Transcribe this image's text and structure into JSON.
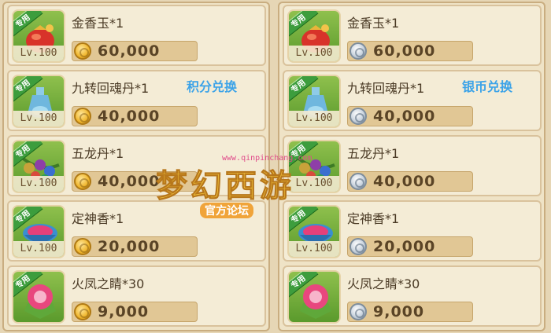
{
  "colors": {
    "badge_green": "#3d9d3d",
    "tag_blue": "#3ca3e8",
    "gold_coin": "#f0b62c",
    "silver_coin": "#c9d3de"
  },
  "left_panel": {
    "tag": "积分兑换",
    "currency_icon": "gold-coin-icon",
    "items": [
      {
        "name": "金香玉*1",
        "badge": "专用",
        "level": "Lv.100",
        "price": "60,000",
        "icon": "red-pouch-icon"
      },
      {
        "name": "九转回魂丹*1",
        "badge": "专用",
        "level": "Lv.100",
        "price": "40,000",
        "icon": "blue-vase-icon"
      },
      {
        "name": "五龙丹*1",
        "badge": "专用",
        "level": "Lv.100",
        "price": "40,000",
        "icon": "beads-branch-icon"
      },
      {
        "name": "定神香*1",
        "badge": "专用",
        "level": "Lv.100",
        "price": "20,000",
        "icon": "incense-bowl-icon"
      },
      {
        "name": "火凤之睛*30",
        "badge": "专用",
        "level": "",
        "price": "9,000",
        "icon": "pink-gem-icon"
      }
    ]
  },
  "right_panel": {
    "tag": "银币兑换",
    "currency_icon": "silver-coin-icon",
    "items": [
      {
        "name": "金香玉*1",
        "badge": "专用",
        "level": "Lv.100",
        "price": "60,000",
        "icon": "red-pouch-icon"
      },
      {
        "name": "九转回魂丹*1",
        "badge": "专用",
        "level": "Lv.100",
        "price": "40,000",
        "icon": "blue-vase-icon"
      },
      {
        "name": "五龙丹*1",
        "badge": "专用",
        "level": "Lv.100",
        "price": "40,000",
        "icon": "beads-branch-icon"
      },
      {
        "name": "定神香*1",
        "badge": "专用",
        "level": "Lv.100",
        "price": "20,000",
        "icon": "incense-bowl-icon"
      },
      {
        "name": "火凤之睛*30",
        "badge": "专用",
        "level": "",
        "price": "9,000",
        "icon": "pink-gem-icon"
      }
    ]
  },
  "watermark": {
    "url": "www.qinpinchang.com",
    "logo": "梦幻西游",
    "subtitle": "官方论坛"
  }
}
